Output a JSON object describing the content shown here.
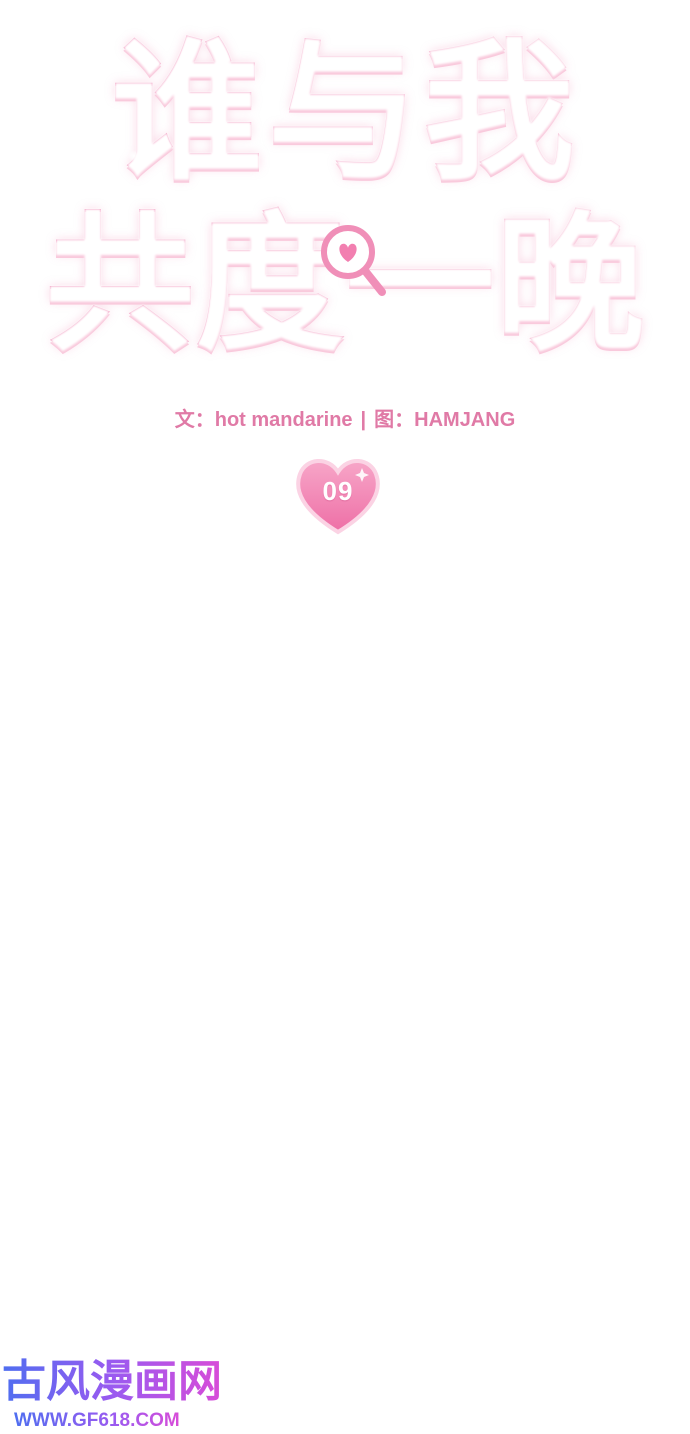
{
  "title": {
    "line1": "谁与我",
    "line2": "共度一晚"
  },
  "credits": {
    "writer_label": "文：",
    "writer": "hot mandarine",
    "separator": "|",
    "artist_label": "图：",
    "artist": "HAMJANG"
  },
  "chapter": {
    "number": "09"
  },
  "watermark": {
    "logo": "古风漫画网",
    "url": "WWW.GF618.COM"
  },
  "colors": {
    "title_pink": "#f08fb8",
    "credits_pink": "#e07aa6",
    "heart_pink": "#f27fb0",
    "watermark_blue": "#4f6ef0",
    "watermark_magenta": "#d84cd8"
  },
  "icons": {
    "title_decoration": "magnifier-heart-icon",
    "chapter_badge": "heart-icon"
  }
}
